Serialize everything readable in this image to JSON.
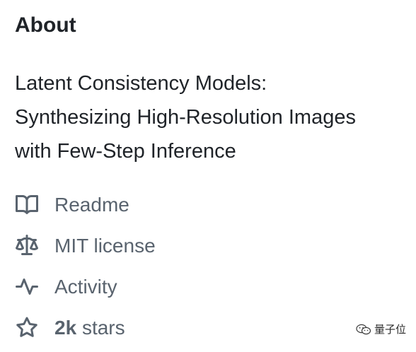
{
  "about": {
    "heading": "About",
    "description_lines": [
      "Latent Consistency Models:",
      "Synthesizing High-Resolution Images",
      "with Few-Step Inference"
    ],
    "items": [
      {
        "icon": "book-icon",
        "label": "Readme"
      },
      {
        "icon": "scale-icon",
        "label": "MIT license"
      },
      {
        "icon": "pulse-icon",
        "label": "Activity"
      },
      {
        "icon": "star-icon",
        "count": "2k",
        "label": "stars"
      }
    ]
  },
  "watermark": {
    "text": "量子位",
    "icon": "wechat-icon"
  },
  "colors": {
    "heading": "#1f2328",
    "muted": "#59636e",
    "background": "#ffffff"
  }
}
